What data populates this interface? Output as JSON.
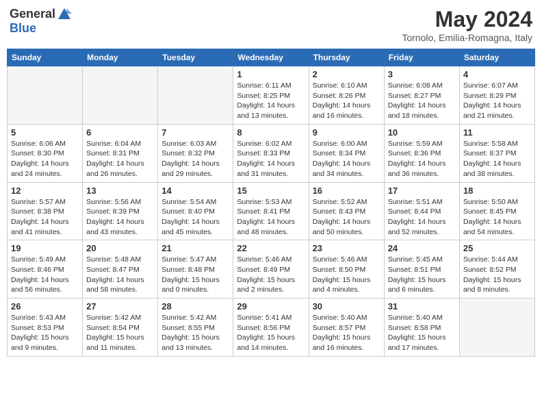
{
  "header": {
    "logo_general": "General",
    "logo_blue": "Blue",
    "month_year": "May 2024",
    "location": "Tornolo, Emilia-Romagna, Italy"
  },
  "days_of_week": [
    "Sunday",
    "Monday",
    "Tuesday",
    "Wednesday",
    "Thursday",
    "Friday",
    "Saturday"
  ],
  "weeks": [
    [
      {
        "day": "",
        "info": ""
      },
      {
        "day": "",
        "info": ""
      },
      {
        "day": "",
        "info": ""
      },
      {
        "day": "1",
        "info": "Sunrise: 6:11 AM\nSunset: 8:25 PM\nDaylight: 14 hours and 13 minutes."
      },
      {
        "day": "2",
        "info": "Sunrise: 6:10 AM\nSunset: 8:26 PM\nDaylight: 14 hours and 16 minutes."
      },
      {
        "day": "3",
        "info": "Sunrise: 6:08 AM\nSunset: 8:27 PM\nDaylight: 14 hours and 18 minutes."
      },
      {
        "day": "4",
        "info": "Sunrise: 6:07 AM\nSunset: 8:29 PM\nDaylight: 14 hours and 21 minutes."
      }
    ],
    [
      {
        "day": "5",
        "info": "Sunrise: 6:06 AM\nSunset: 8:30 PM\nDaylight: 14 hours and 24 minutes."
      },
      {
        "day": "6",
        "info": "Sunrise: 6:04 AM\nSunset: 8:31 PM\nDaylight: 14 hours and 26 minutes."
      },
      {
        "day": "7",
        "info": "Sunrise: 6:03 AM\nSunset: 8:32 PM\nDaylight: 14 hours and 29 minutes."
      },
      {
        "day": "8",
        "info": "Sunrise: 6:02 AM\nSunset: 8:33 PM\nDaylight: 14 hours and 31 minutes."
      },
      {
        "day": "9",
        "info": "Sunrise: 6:00 AM\nSunset: 8:34 PM\nDaylight: 14 hours and 34 minutes."
      },
      {
        "day": "10",
        "info": "Sunrise: 5:59 AM\nSunset: 8:36 PM\nDaylight: 14 hours and 36 minutes."
      },
      {
        "day": "11",
        "info": "Sunrise: 5:58 AM\nSunset: 8:37 PM\nDaylight: 14 hours and 38 minutes."
      }
    ],
    [
      {
        "day": "12",
        "info": "Sunrise: 5:57 AM\nSunset: 8:38 PM\nDaylight: 14 hours and 41 minutes."
      },
      {
        "day": "13",
        "info": "Sunrise: 5:56 AM\nSunset: 8:39 PM\nDaylight: 14 hours and 43 minutes."
      },
      {
        "day": "14",
        "info": "Sunrise: 5:54 AM\nSunset: 8:40 PM\nDaylight: 14 hours and 45 minutes."
      },
      {
        "day": "15",
        "info": "Sunrise: 5:53 AM\nSunset: 8:41 PM\nDaylight: 14 hours and 48 minutes."
      },
      {
        "day": "16",
        "info": "Sunrise: 5:52 AM\nSunset: 8:43 PM\nDaylight: 14 hours and 50 minutes."
      },
      {
        "day": "17",
        "info": "Sunrise: 5:51 AM\nSunset: 8:44 PM\nDaylight: 14 hours and 52 minutes."
      },
      {
        "day": "18",
        "info": "Sunrise: 5:50 AM\nSunset: 8:45 PM\nDaylight: 14 hours and 54 minutes."
      }
    ],
    [
      {
        "day": "19",
        "info": "Sunrise: 5:49 AM\nSunset: 8:46 PM\nDaylight: 14 hours and 56 minutes."
      },
      {
        "day": "20",
        "info": "Sunrise: 5:48 AM\nSunset: 8:47 PM\nDaylight: 14 hours and 58 minutes."
      },
      {
        "day": "21",
        "info": "Sunrise: 5:47 AM\nSunset: 8:48 PM\nDaylight: 15 hours and 0 minutes."
      },
      {
        "day": "22",
        "info": "Sunrise: 5:46 AM\nSunset: 8:49 PM\nDaylight: 15 hours and 2 minutes."
      },
      {
        "day": "23",
        "info": "Sunrise: 5:46 AM\nSunset: 8:50 PM\nDaylight: 15 hours and 4 minutes."
      },
      {
        "day": "24",
        "info": "Sunrise: 5:45 AM\nSunset: 8:51 PM\nDaylight: 15 hours and 6 minutes."
      },
      {
        "day": "25",
        "info": "Sunrise: 5:44 AM\nSunset: 8:52 PM\nDaylight: 15 hours and 8 minutes."
      }
    ],
    [
      {
        "day": "26",
        "info": "Sunrise: 5:43 AM\nSunset: 8:53 PM\nDaylight: 15 hours and 9 minutes."
      },
      {
        "day": "27",
        "info": "Sunrise: 5:42 AM\nSunset: 8:54 PM\nDaylight: 15 hours and 11 minutes."
      },
      {
        "day": "28",
        "info": "Sunrise: 5:42 AM\nSunset: 8:55 PM\nDaylight: 15 hours and 13 minutes."
      },
      {
        "day": "29",
        "info": "Sunrise: 5:41 AM\nSunset: 8:56 PM\nDaylight: 15 hours and 14 minutes."
      },
      {
        "day": "30",
        "info": "Sunrise: 5:40 AM\nSunset: 8:57 PM\nDaylight: 15 hours and 16 minutes."
      },
      {
        "day": "31",
        "info": "Sunrise: 5:40 AM\nSunset: 8:58 PM\nDaylight: 15 hours and 17 minutes."
      },
      {
        "day": "",
        "info": ""
      }
    ]
  ]
}
